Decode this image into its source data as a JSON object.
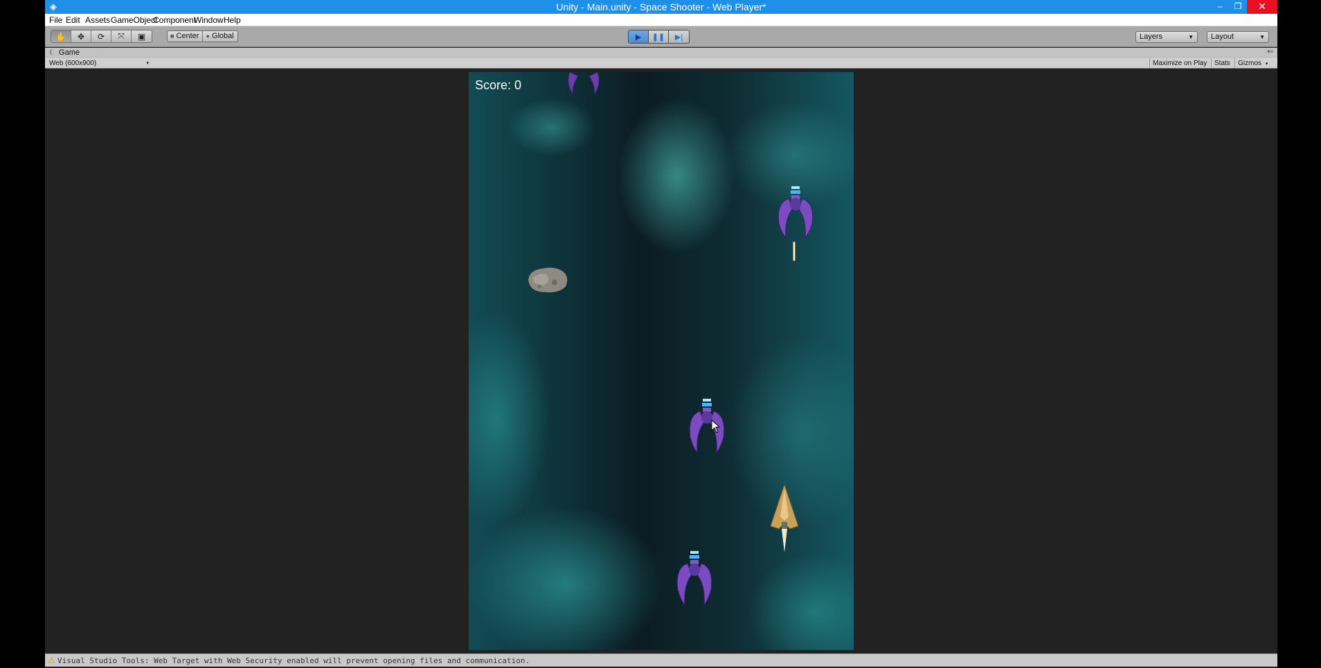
{
  "window": {
    "title": "Unity - Main.unity - Space Shooter - Web Player*",
    "logo_icon": "unity-logo-icon",
    "controls": {
      "minimize": "–",
      "maximize": "❐",
      "close": "✕"
    }
  },
  "menu": [
    "File",
    "Edit",
    "Assets",
    "GameObject",
    "Component",
    "Window",
    "Help"
  ],
  "toolbar": {
    "transform_tools": [
      {
        "name": "hand-tool",
        "icon": "✋"
      },
      {
        "name": "move-tool",
        "icon": "✥"
      },
      {
        "name": "rotate-tool",
        "icon": "⟳"
      },
      {
        "name": "scale-tool",
        "icon": "⤧"
      },
      {
        "name": "rect-tool",
        "icon": "▣"
      }
    ],
    "pivot_mode": "Center",
    "pivot_rotation": "Global",
    "play_icon": "▶",
    "pause_icon": "❚❚",
    "step_icon": "▶|",
    "layers_label": "Layers",
    "layout_label": "Layout",
    "dropdown_arrow": "▼",
    "accent_color": "#4d8ad6"
  },
  "game_view": {
    "tab_label": "Game",
    "tab_icon": "☾",
    "tab_menu_icon": "▾≡",
    "resolution": "Web (600x900)",
    "resolution_arrow": "▾",
    "maximize_on_play": "Maximize on Play",
    "stats": "Stats",
    "gizmos": "Gizmos",
    "gizmos_arrow": "▾"
  },
  "game": {
    "score_text": "Score: 0"
  },
  "status": {
    "warning_icon": "⚠",
    "message": "Visual Studio Tools: Web Target with Web Security enabled will prevent opening files and communication."
  }
}
